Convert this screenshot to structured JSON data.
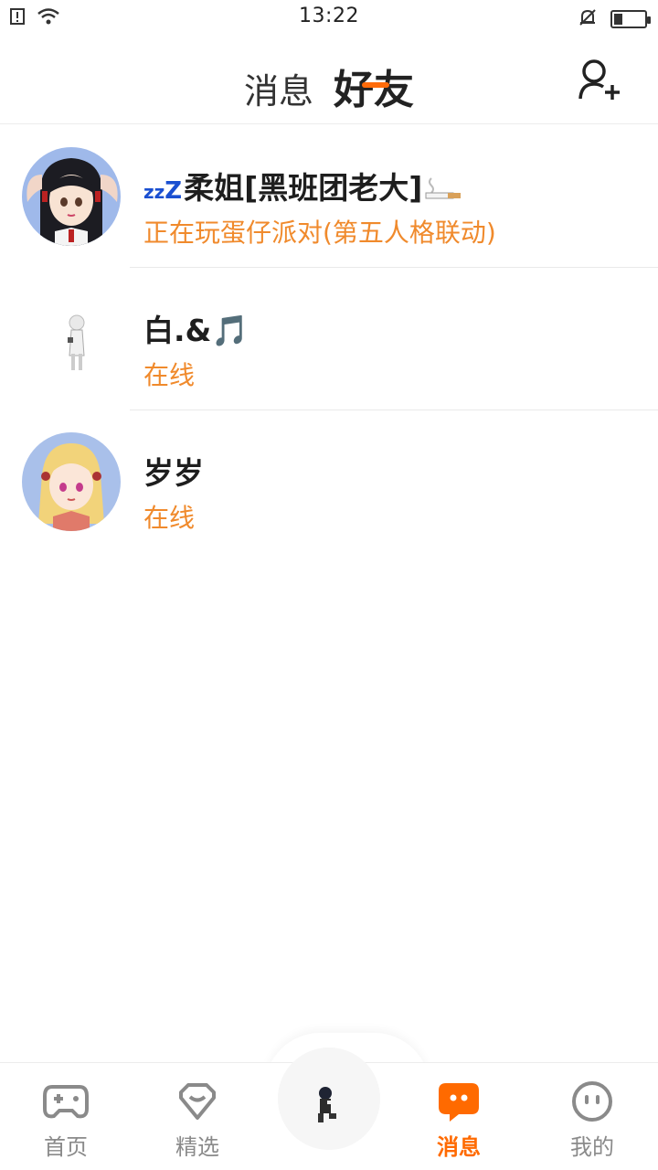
{
  "status_bar": {
    "time": "13:22",
    "icons": [
      "alert-icon",
      "wifi-icon",
      "mute-icon",
      "battery-icon"
    ]
  },
  "header": {
    "tabs": [
      {
        "label": "消息",
        "active": false
      },
      {
        "label": "好友",
        "active": true
      }
    ],
    "accent_color": "#ff6b0a",
    "add_friend_icon": "add-user-icon"
  },
  "friends": [
    {
      "prefix": "zzZ",
      "name": "柔姐[黑班团老大]",
      "suffix_icon": "cigarette-icon",
      "status": "正在玩蛋仔派对(第五人格联动)"
    },
    {
      "name": "白.&🎵",
      "status": "在线"
    },
    {
      "name": "岁岁",
      "status": "在线"
    }
  ],
  "bottom_nav": [
    {
      "label": "首页",
      "icon": "gamepad-icon",
      "active": false
    },
    {
      "label": "精选",
      "icon": "heart-icon",
      "active": false
    },
    {
      "label": "",
      "icon": "avatar-center",
      "active": false
    },
    {
      "label": "消息",
      "icon": "chat-icon",
      "active": true
    },
    {
      "label": "我的",
      "icon": "face-icon",
      "active": false
    }
  ],
  "colors": {
    "status_text": "#f08a2c",
    "active_nav": "#ff6a00",
    "inactive_nav": "#8a8a8a"
  }
}
